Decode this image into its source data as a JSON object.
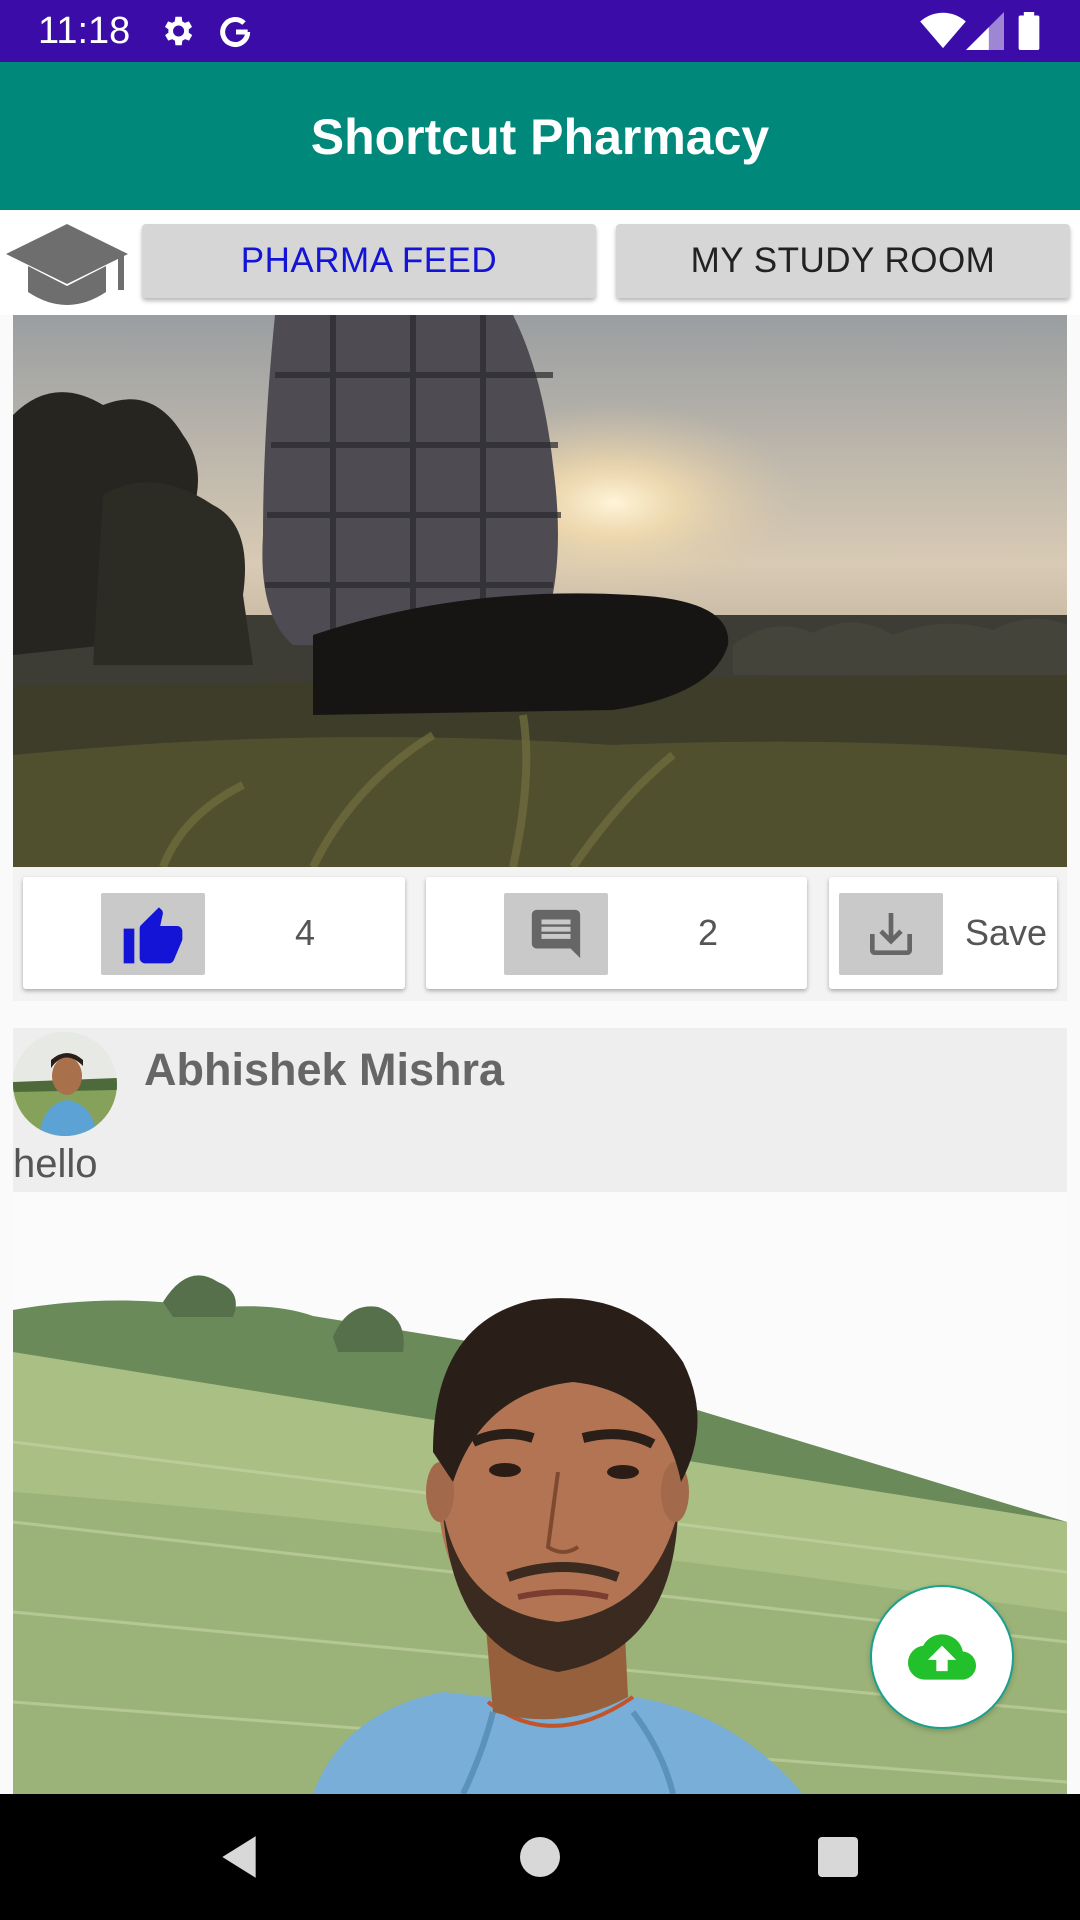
{
  "status_bar": {
    "time": "11:18",
    "icons": [
      "settings-icon",
      "google-icon",
      "wifi-icon",
      "signal-icon",
      "battery-icon"
    ]
  },
  "app_bar": {
    "title": "Shortcut Pharmacy"
  },
  "tabs": [
    {
      "label": "PHARMA FEED",
      "selected": true,
      "color": "#1414d6"
    },
    {
      "label": "MY STUDY ROOM",
      "selected": false,
      "color": "#222222"
    }
  ],
  "posts": [
    {
      "image": "sunset-field-photo",
      "actions": {
        "likes": "4",
        "comments": "2",
        "save_label": "Save"
      }
    },
    {
      "author": "Abhishek Mishra",
      "caption": "hello",
      "image": "selfie-field-photo"
    }
  ],
  "fab_icon": "cloud-upload-icon",
  "colors": {
    "status_bar": "#3c0ca8",
    "app_bar": "#00897b",
    "like_icon": "#1414d6",
    "fab_icon": "#22c02a"
  }
}
